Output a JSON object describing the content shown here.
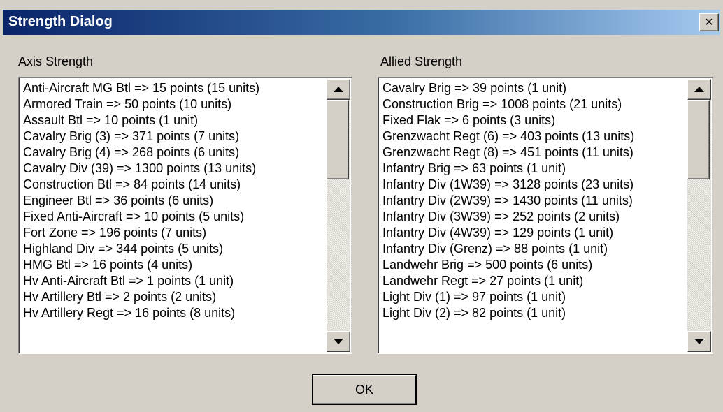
{
  "window": {
    "title": "Strength Dialog",
    "close_glyph": "×"
  },
  "axis": {
    "label": "Axis Strength",
    "items": [
      "Anti-Aircraft MG Btl => 15 points (15 units)",
      "Armored Train => 50 points (10 units)",
      "Assault Btl => 10 points (1 unit)",
      "Cavalry Brig (3) => 371 points (7 units)",
      "Cavalry Brig (4) => 268 points (6 units)",
      "Cavalry Div (39) => 1300 points (13 units)",
      "Construction Btl => 84 points (14 units)",
      "Engineer Btl => 36 points (6 units)",
      "Fixed Anti-Aircraft => 10 points (5 units)",
      "Fort Zone => 196 points (7 units)",
      "Highland Div => 344 points (5 units)",
      "HMG Btl => 16 points (4 units)",
      "Hv Anti-Aircraft Btl => 1 points (1 unit)",
      "Hv Artillery Btl => 2 points (2 units)",
      "Hv Artillery Regt => 16 points (8 units)"
    ]
  },
  "allied": {
    "label": "Allied Strength",
    "items": [
      "Cavalry Brig => 39 points (1 unit)",
      "Construction Brig => 1008 points (21 units)",
      "Fixed Flak => 6 points (3 units)",
      "Grenzwacht Regt (6) => 403 points (13 units)",
      "Grenzwacht Regt (8) => 451 points (11 units)",
      "Infantry Brig => 63 points (1 unit)",
      "Infantry Div (1W39) => 3128 points (23 units)",
      "Infantry Div (2W39) => 1430 points (11 units)",
      "Infantry Div (3W39) => 252 points (2 units)",
      "Infantry Div (4W39) => 129 points (1 unit)",
      "Infantry Div (Grenz) => 88 points (1 unit)",
      "Landwehr Brig => 500 points (6 units)",
      "Landwehr Regt => 27 points (1 unit)",
      "Light Div (1) => 97 points (1 unit)",
      "Light Div (2) => 82 points (1 unit)"
    ]
  },
  "buttons": {
    "ok_label": "OK"
  },
  "colors": {
    "titlebar_start": "#0a246a",
    "titlebar_end": "#a6caf0",
    "dialog_bg": "#d4d0c8"
  }
}
